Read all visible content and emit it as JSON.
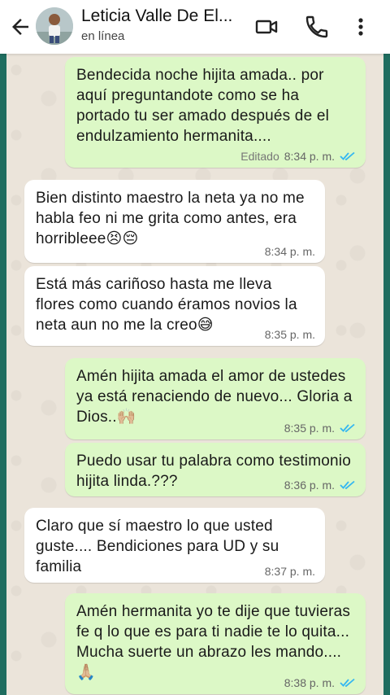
{
  "header": {
    "contact_name": "Leticia Valle De El...",
    "status": "en línea",
    "colors": {
      "tick_read": "#34b7f1",
      "outgoing_bubble": "#dcf8c6"
    }
  },
  "messages": [
    {
      "direction": "out",
      "text": "Bendecida noche hijita amada.. por aquí preguntandote como se ha portado tu ser amado después de el endulzamiento hermanita....",
      "edited": "Editado",
      "time": "8:34 p. m.",
      "read": true
    },
    {
      "direction": "in",
      "text": "Bien distinto maestro la neta ya no me habla feo ni me grita como antes, era horribleee😣😔",
      "time": "8:34 p. m."
    },
    {
      "direction": "in",
      "text": "Está más cariñoso hasta me lleva flores como cuando éramos novios la neta aun no me la creo😅",
      "time": "8:35 p. m."
    },
    {
      "direction": "out",
      "text": "Amén hijita amada el amor de ustedes ya está renaciendo de nuevo... Gloria a Dios..🙌🏼",
      "time": "8:35 p. m.",
      "read": true
    },
    {
      "direction": "out",
      "text": "Puedo usar tu palabra como testimonio hijita linda.???",
      "time": "8:36 p. m.",
      "read": true
    },
    {
      "direction": "in",
      "text": "Claro que sí maestro lo que usted guste.... Bendiciones para UD y su familia",
      "time": "8:37 p. m."
    },
    {
      "direction": "out",
      "text": "Amén hermanita yo te dije que tuvieras fe q lo que es para ti nadie te lo quita... Mucha suerte un abrazo les mando....🙏🏼",
      "time": "8:38 p. m.",
      "read": true
    }
  ]
}
